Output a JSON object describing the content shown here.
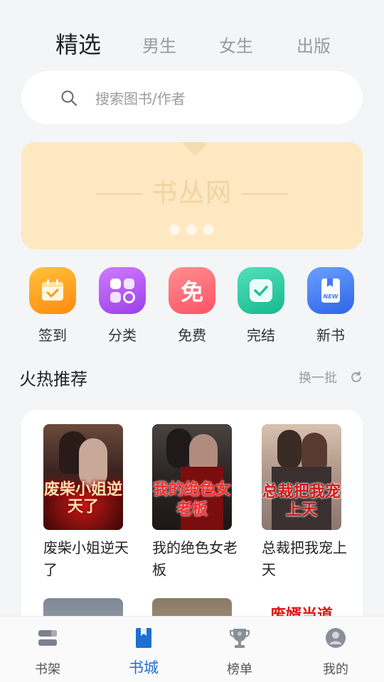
{
  "tabs": [
    "精选",
    "男生",
    "女生",
    "出版"
  ],
  "search": {
    "placeholder": "搜索图书/作者"
  },
  "banner": {
    "brand": "书丛网",
    "dots": 3
  },
  "quick_actions": [
    {
      "label": "签到",
      "icon": "checkin-calendar-icon",
      "color": "#ffa41b"
    },
    {
      "label": "分类",
      "icon": "category-grid-icon",
      "color": "#b056f2"
    },
    {
      "label": "免费",
      "icon": "free-icon",
      "glyph": "免",
      "color": "#ff6f7a"
    },
    {
      "label": "完结",
      "icon": "finished-check-icon",
      "color": "#23c9a6"
    },
    {
      "label": "新书",
      "icon": "new-book-icon",
      "color": "#3f7cf2",
      "badge": "NEW"
    }
  ],
  "section": {
    "title": "火热推荐",
    "refresh_label": "换一批"
  },
  "books": [
    {
      "title": "废柴小姐逆天了",
      "cover_text": "废柴小姐逆天了"
    },
    {
      "title": "我的绝色女老板",
      "cover_text": "我的绝色女老板"
    },
    {
      "title": "总裁把我宠上天",
      "cover_text": "总裁把我宠上天"
    }
  ],
  "books_row2_partial": {
    "cover_text": "废婿当道"
  },
  "bottom_nav": [
    {
      "label": "书架",
      "icon": "bookshelf-icon"
    },
    {
      "label": "书城",
      "icon": "bookstore-icon",
      "active": true
    },
    {
      "label": "榜单",
      "icon": "trophy-icon"
    },
    {
      "label": "我的",
      "icon": "profile-icon"
    }
  ]
}
